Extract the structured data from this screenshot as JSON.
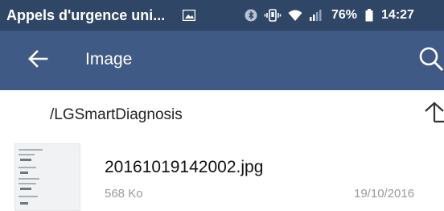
{
  "status_bar": {
    "title": "Appels d'urgence uni...",
    "battery_percent": "76%",
    "time": "14:27",
    "icons": [
      "image-icon",
      "bluetooth-icon",
      "vibrate-icon",
      "wifi-icon",
      "signal-icon",
      "battery-icon"
    ]
  },
  "app_bar": {
    "title": "Image",
    "back_icon": "arrow-left-icon",
    "search_icon": "search-icon"
  },
  "path_bar": {
    "path": "/LGSmartDiagnosis",
    "up_icon": "arrow-up-icon"
  },
  "files": [
    {
      "name": "20161019142002.jpg",
      "size": "568 Ko",
      "date": "19/10/2016"
    }
  ],
  "colors": {
    "status_bar": "#2f4667",
    "app_bar": "#3f5a84",
    "background": "#ffffff"
  }
}
